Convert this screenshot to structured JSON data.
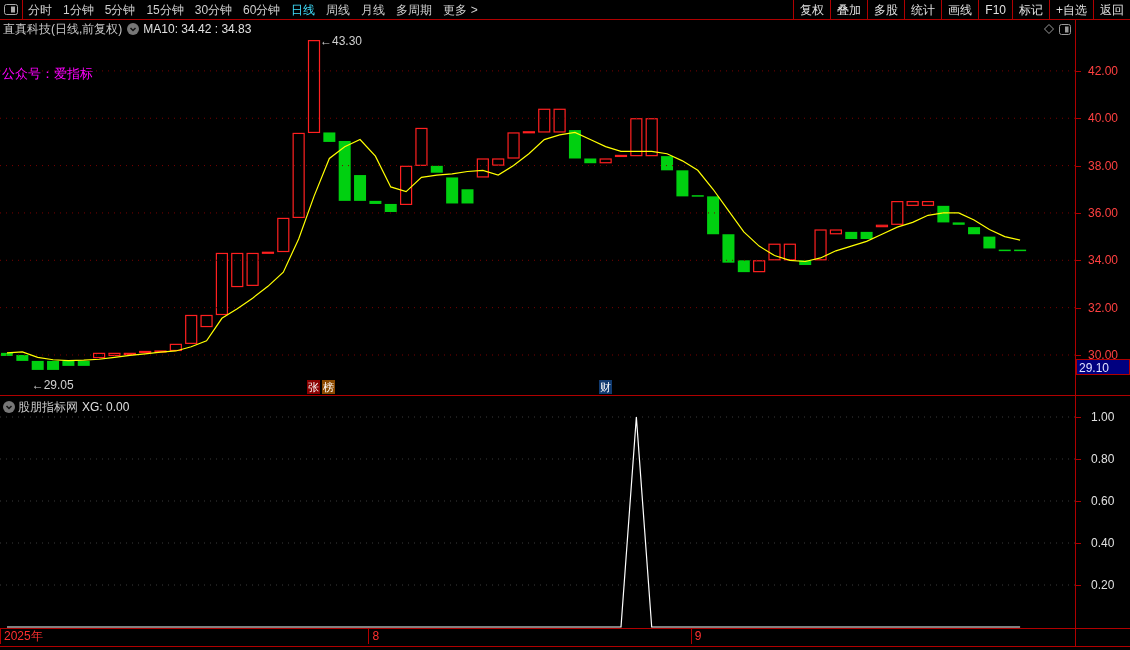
{
  "toolbar": {
    "period_tabs": [
      {
        "label": "分时",
        "selected": false
      },
      {
        "label": "1分钟",
        "selected": false
      },
      {
        "label": "5分钟",
        "selected": false
      },
      {
        "label": "15分钟",
        "selected": false
      },
      {
        "label": "30分钟",
        "selected": false
      },
      {
        "label": "60分钟",
        "selected": false
      },
      {
        "label": "日线",
        "selected": true
      },
      {
        "label": "周线",
        "selected": false
      },
      {
        "label": "月线",
        "selected": false
      },
      {
        "label": "多周期",
        "selected": false
      },
      {
        "label": "更多 >",
        "selected": false
      }
    ],
    "buttons": [
      "复权",
      "叠加",
      "多股",
      "统计",
      "画线",
      "F10",
      "标记",
      "+自选",
      "返回"
    ]
  },
  "chart_header": {
    "title": "直真科技(日线,前复权)",
    "indicator_values": ": 34.42 : 34.83"
  },
  "overlay_text": "公众号：爱指标",
  "price_labels": [
    "←43.30",
    "←29.05"
  ],
  "last_price": "29.10",
  "event_tags": [
    {
      "text": "张",
      "color": "#8b0000"
    },
    {
      "text": "榜",
      "color": "#8b4a00"
    },
    {
      "text": "财",
      "color": "#103a70"
    }
  ],
  "main_chart": {
    "chart_data": {
      "type": "line",
      "grid": true,
      "ylim": [
        28.31,
        44.15
      ],
      "yticks": [
        {
          "value": 30,
          "label": "30.00"
        },
        {
          "value": 32,
          "label": "32.00"
        },
        {
          "value": 34,
          "label": "34.00"
        },
        {
          "value": 36,
          "label": "36.00"
        },
        {
          "value": 38,
          "label": "38.00"
        },
        {
          "value": 40,
          "label": "40.00"
        },
        {
          "value": 42,
          "label": "42.00"
        }
      ],
      "series": [
        {
          "name": "MA10",
          "color": "#ffff00",
          "values": [
            30.09,
            30.13,
            29.9,
            29.8,
            29.76,
            29.78,
            29.82,
            29.9,
            29.98,
            30.05,
            30.12,
            30.17,
            30.35,
            30.6,
            31.55,
            31.95,
            32.4,
            32.9,
            33.5,
            34.9,
            36.7,
            38.3,
            38.8,
            39.1,
            38.4,
            37.1,
            36.9,
            37.5,
            37.6,
            37.65,
            37.75,
            37.8,
            37.6,
            38.0,
            38.5,
            39.1,
            39.3,
            39.4,
            39.1,
            38.8,
            38.6,
            38.6,
            38.6,
            38.5,
            38.2,
            37.8,
            37.0,
            36.1,
            35.2,
            34.6,
            34.2,
            34.0,
            33.95,
            34.1,
            34.4,
            34.6,
            34.8,
            35.1,
            35.4,
            35.6,
            35.9,
            36.0,
            36.0,
            35.7,
            35.3,
            35.0,
            34.85
          ]
        }
      ]
    }
  },
  "indicator_panel": {
    "title": "股朋指标网",
    "reading": ": 0.00",
    "date_axis": [
      "2025年",
      "8",
      "9"
    ],
    "chart_data": {
      "type": "line",
      "grid": true,
      "ylim": [
        0,
        1
      ],
      "yticks": [
        {
          "value": 0.2,
          "label": "0.20"
        },
        {
          "value": 0.4,
          "label": "0.40"
        },
        {
          "value": 0.6,
          "label": "0.60"
        },
        {
          "value": 0.8,
          "label": "0.80"
        },
        {
          "value": 1,
          "label": "1.00"
        }
      ],
      "series": [
        {
          "name": "XG",
          "color": "#ffffff",
          "values": [
            0,
            0,
            0,
            0,
            0,
            0,
            0,
            0,
            0,
            0,
            0,
            0,
            0,
            0,
            0,
            0,
            0,
            0,
            0,
            0,
            0,
            0,
            0,
            0,
            0,
            0,
            0,
            0,
            0,
            0,
            0,
            0,
            0,
            0,
            0,
            0,
            0,
            0,
            0,
            0,
            0,
            1,
            0,
            0,
            0,
            0,
            0,
            0,
            0,
            0,
            0,
            0,
            0,
            0,
            0,
            0,
            0,
            0,
            0,
            0,
            0,
            0,
            0,
            0,
            0,
            0,
            0
          ]
        }
      ]
    }
  }
}
